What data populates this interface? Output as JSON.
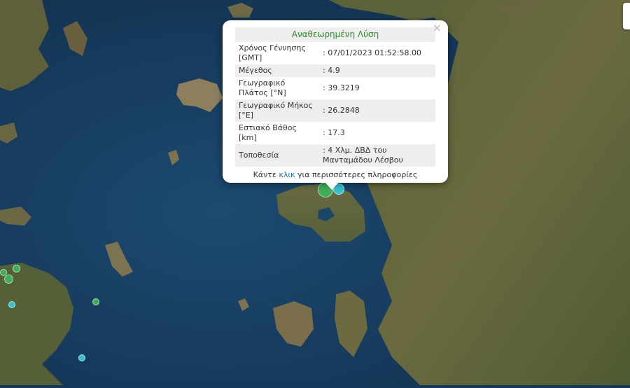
{
  "popup": {
    "title": "Αναθεωρημένη Λύση",
    "close_label": "×",
    "rows": [
      {
        "label": "Χρόνος Γέννησης [GMT]",
        "value": ": 07/01/2023 01:52:58.00"
      },
      {
        "label": "Μέγεθος",
        "value": ": 4.9"
      },
      {
        "label": "Γεωγραφικό Πλάτος [°N]",
        "value": ": 39.3219"
      },
      {
        "label": "Γεωγραφικό Μήκος [°E]",
        "value": ": 26.2848"
      },
      {
        "label": "Εστιακό Βάθος [km]",
        "value": ": 17.3"
      },
      {
        "label": "Τοποθεσία",
        "value": ": 4 Χλμ. ΔΒΔ του Μανταμάδου Λέσβου"
      }
    ],
    "footer_before": "Κάντε ",
    "footer_link": "κλικ",
    "footer_after": " για περισσότερες πληροφορίες"
  },
  "colors": {
    "sea": "#163a5c",
    "land": "#4a5530",
    "marker_recent": "#34c1d3",
    "marker_older": "#3fae58"
  }
}
